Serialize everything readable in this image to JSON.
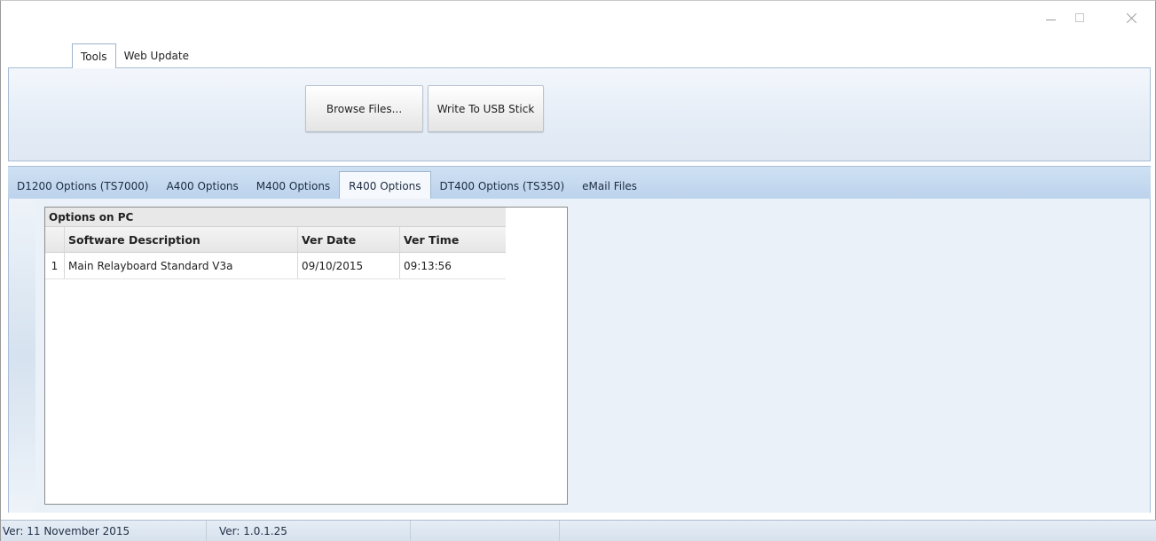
{
  "window": {
    "controls": {
      "minimize_icon": "minimize-icon",
      "maximize_icon": "maximize-icon",
      "close_icon": "close-icon"
    }
  },
  "ribbon": {
    "tabs": [
      {
        "label": "Tools",
        "active": true
      },
      {
        "label": "Web Update",
        "active": false
      }
    ],
    "buttons": {
      "browse_label": "Browse Files...",
      "write_label": "Write To USB Stick"
    }
  },
  "document_tabs": [
    {
      "label": "D1200 Options (TS7000)",
      "active": false
    },
    {
      "label": "A400 Options",
      "active": false
    },
    {
      "label": "M400 Options",
      "active": false
    },
    {
      "label": "R400 Options",
      "active": true
    },
    {
      "label": "DT400 Options (TS350)",
      "active": false
    },
    {
      "label": "eMail Files",
      "active": false
    }
  ],
  "grid": {
    "group_title": "Options on PC",
    "columns": [
      "Software Description",
      "Ver Date",
      "Ver Time"
    ],
    "rows": [
      {
        "num": "1",
        "description": "Main Relayboard Standard V3a",
        "ver_date": "09/10/2015",
        "ver_time": "09:13:56"
      }
    ]
  },
  "status_bar": {
    "date_text": "Ver: 11 November 2015",
    "version_text": "Ver: 1.0.1.25"
  },
  "colors": {
    "accent": "#bcd3ec",
    "ribbon_bg": "#e4ecf6",
    "content_bg": "#eaf1f8"
  }
}
